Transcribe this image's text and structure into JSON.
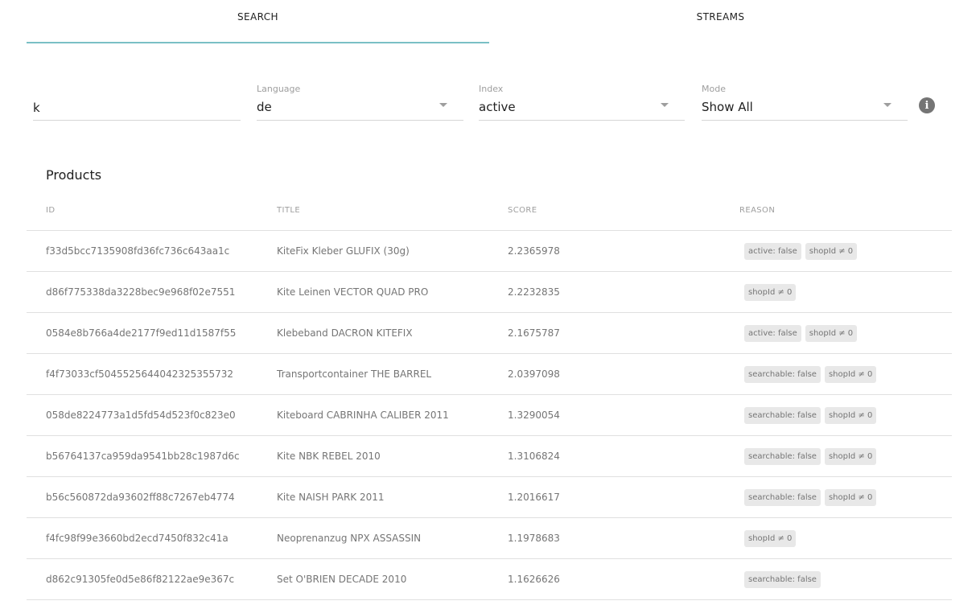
{
  "tabs": [
    {
      "label": "SEARCH",
      "active": true
    },
    {
      "label": "STREAMS",
      "active": false
    }
  ],
  "filters": {
    "query": {
      "value": "k"
    },
    "language": {
      "label": "Language",
      "value": "de"
    },
    "index": {
      "label": "Index",
      "value": "active"
    },
    "mode": {
      "label": "Mode",
      "value": "Show All"
    }
  },
  "info_icon": "info-icon",
  "products": {
    "title": "Products",
    "columns": [
      "ID",
      "TITLE",
      "SCORE",
      "REASON"
    ],
    "rows": [
      {
        "id": "f33d5bcc7135908fd36fc736c643aa1c",
        "title": "KiteFix Kleber GLUFIX (30g)",
        "score": "2.2365978",
        "reasons": [
          "active: false",
          "shopId ≠ 0"
        ]
      },
      {
        "id": "d86f775338da3228bec9e968f02e7551",
        "title": "Kite Leinen VECTOR QUAD PRO",
        "score": "2.2232835",
        "reasons": [
          "shopId ≠ 0"
        ]
      },
      {
        "id": "0584e8b766a4de2177f9ed11d1587f55",
        "title": "Klebeband DACRON KITEFIX",
        "score": "2.1675787",
        "reasons": [
          "active: false",
          "shopId ≠ 0"
        ]
      },
      {
        "id": "f4f73033cf5045525644042325355732",
        "title": "Transportcontainer THE BARREL",
        "score": "2.0397098",
        "reasons": [
          "searchable: false",
          "shopId ≠ 0"
        ]
      },
      {
        "id": "058de8224773a1d5fd54d523f0c823e0",
        "title": "Kiteboard CABRINHA CALIBER 2011",
        "score": "1.3290054",
        "reasons": [
          "searchable: false",
          "shopId ≠ 0"
        ]
      },
      {
        "id": "b56764137ca959da9541bb28c1987d6c",
        "title": "Kite NBK REBEL 2010",
        "score": "1.3106824",
        "reasons": [
          "searchable: false",
          "shopId ≠ 0"
        ]
      },
      {
        "id": "b56c560872da93602ff88c7267eb4774",
        "title": "Kite NAISH PARK 2011",
        "score": "1.2016617",
        "reasons": [
          "searchable: false",
          "shopId ≠ 0"
        ]
      },
      {
        "id": "f4fc98f99e3660bd2ecd7450f832c41a",
        "title": "Neoprenanzug NPX ASSASSIN",
        "score": "1.1978683",
        "reasons": [
          "shopId ≠ 0"
        ]
      },
      {
        "id": "d862c91305fe0d5e86f82122ae9e367c",
        "title": "Set O'BRIEN DECADE 2010",
        "score": "1.1626626",
        "reasons": [
          "searchable: false"
        ]
      }
    ]
  }
}
